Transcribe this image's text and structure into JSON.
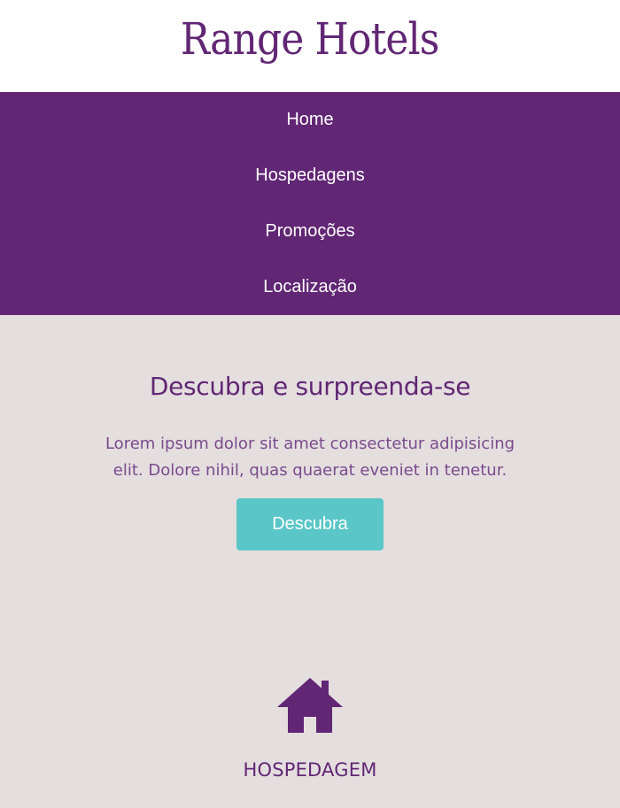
{
  "header": {
    "logo_text": "Range Hotels"
  },
  "nav": {
    "items": [
      {
        "label": "Home"
      },
      {
        "label": "Hospedagens"
      },
      {
        "label": "Promoções"
      },
      {
        "label": "Localização"
      }
    ]
  },
  "hero": {
    "title": "Descubra e surpreenda-se",
    "text": "Lorem ipsum dolor sit amet consectetur adipisicing elit. Dolore nihil, quas quaerat eveniet in tenetur.",
    "button_label": "Descubra"
  },
  "features": {
    "items": [
      {
        "icon": "house-icon",
        "title": "HOSPEDAGEM"
      }
    ]
  },
  "colors": {
    "brand_purple": "#612674",
    "accent_teal": "#5bc6c7",
    "background": "#e4dedf"
  }
}
